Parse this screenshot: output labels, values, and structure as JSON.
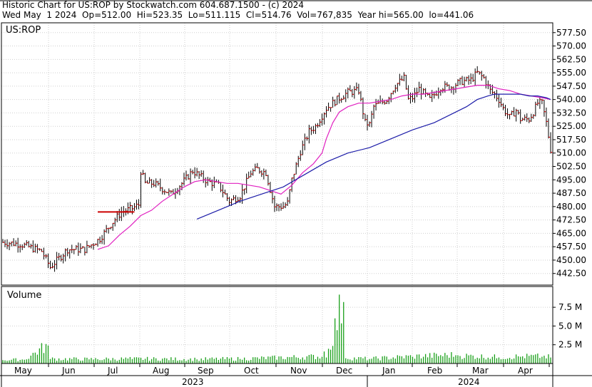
{
  "header": {
    "line1": "Historic Chart for US:ROP by Stockwatch.com 604.687.1500 - (c) 2024",
    "line2": "Wed May  1 2024  Op=512.00  Hi=523.35  Lo=511.115  Cl=514.76  Vol=767,835  Year hi=565.00  lo=441.06"
  },
  "colors": {
    "price_bar": "#000000",
    "close_tick": "#cc0000",
    "ma_short": "#e020c0",
    "ma_long": "#1c1ca8",
    "volume": "#1aa01a",
    "grid": "#cfcfcf",
    "red_marker": "#cc0000"
  },
  "chart_data": [
    {
      "type": "bar",
      "subtype": "ohlc",
      "symbol_label": "US:ROP",
      "ylim": [
        436.0,
        583.0
      ],
      "yticks": [
        "577.50",
        "570.00",
        "562.50",
        "555.00",
        "547.50",
        "540.00",
        "532.50",
        "525.00",
        "517.50",
        "510.00",
        "502.50",
        "495.00",
        "487.50",
        "480.00",
        "472.50",
        "465.00",
        "457.50",
        "450.00",
        "442.50"
      ],
      "months": [
        "May",
        "Jun",
        "Jul",
        "Aug",
        "Sep",
        "Oct",
        "Nov",
        "Dec",
        "Jan",
        "Feb",
        "Mar",
        "Apr"
      ],
      "years": [
        "2023",
        "2024"
      ],
      "grid": true,
      "anchors_close": [
        [
          0,
          460
        ],
        [
          8,
          459
        ],
        [
          18,
          455
        ],
        [
          22,
          446
        ],
        [
          30,
          456
        ],
        [
          38,
          456
        ],
        [
          45,
          462
        ],
        [
          50,
          470
        ],
        [
          55,
          477
        ],
        [
          60,
          479
        ],
        [
          63,
          481
        ],
        [
          64,
          500
        ],
        [
          66,
          493
        ],
        [
          70,
          493
        ],
        [
          78,
          487
        ],
        [
          83,
          493
        ],
        [
          88,
          500
        ],
        [
          95,
          494
        ],
        [
          100,
          492
        ],
        [
          105,
          483
        ],
        [
          110,
          486
        ],
        [
          115,
          499
        ],
        [
          118,
          501
        ],
        [
          122,
          499
        ],
        [
          126,
          480
        ],
        [
          130,
          480
        ],
        [
          132,
          482
        ],
        [
          134,
          495
        ],
        [
          138,
          511
        ],
        [
          142,
          522
        ],
        [
          145,
          525
        ],
        [
          150,
          535
        ],
        [
          155,
          540
        ],
        [
          160,
          544
        ],
        [
          165,
          545
        ],
        [
          168,
          527
        ],
        [
          170,
          526
        ],
        [
          172,
          536
        ],
        [
          175,
          538
        ],
        [
          178,
          540
        ],
        [
          182,
          548
        ],
        [
          186,
          552
        ],
        [
          188,
          540
        ],
        [
          190,
          541
        ],
        [
          193,
          546
        ],
        [
          198,
          540
        ],
        [
          203,
          547
        ],
        [
          208,
          547
        ],
        [
          212,
          550
        ],
        [
          217,
          551
        ],
        [
          220,
          555
        ],
        [
          223,
          552
        ],
        [
          226,
          545
        ],
        [
          228,
          543
        ],
        [
          230,
          540
        ],
        [
          232,
          535
        ],
        [
          235,
          530
        ],
        [
          238,
          534
        ],
        [
          240,
          529
        ],
        [
          244,
          529
        ],
        [
          246,
          533
        ],
        [
          248,
          538
        ],
        [
          250,
          538
        ],
        [
          252,
          527
        ],
        [
          254,
          512
        ]
      ],
      "ma_short_points": [
        [
          44,
          456
        ],
        [
          49,
          458
        ],
        [
          54,
          464
        ],
        [
          59,
          469
        ],
        [
          64,
          475
        ],
        [
          69,
          478
        ],
        [
          74,
          483
        ],
        [
          79,
          487
        ],
        [
          84,
          491
        ],
        [
          89,
          494
        ],
        [
          94,
          495
        ],
        [
          99,
          494
        ],
        [
          104,
          493
        ],
        [
          109,
          493
        ],
        [
          114,
          492
        ],
        [
          119,
          491
        ],
        [
          124,
          489
        ],
        [
          129,
          487
        ],
        [
          134,
          492
        ],
        [
          139,
          499
        ],
        [
          144,
          504
        ],
        [
          148,
          510
        ],
        [
          150,
          518
        ],
        [
          153,
          527
        ],
        [
          156,
          533
        ],
        [
          160,
          536
        ],
        [
          165,
          538
        ],
        [
          170,
          538
        ],
        [
          175,
          539
        ],
        [
          180,
          540
        ],
        [
          185,
          542
        ],
        [
          190,
          543
        ],
        [
          195,
          543
        ],
        [
          200,
          544
        ],
        [
          205,
          545
        ],
        [
          210,
          546
        ],
        [
          215,
          547
        ],
        [
          220,
          548
        ],
        [
          225,
          548
        ],
        [
          230,
          546
        ],
        [
          235,
          545
        ],
        [
          240,
          543
        ],
        [
          245,
          542
        ],
        [
          250,
          541
        ],
        [
          254,
          540
        ]
      ],
      "ma_long_points": [
        [
          90,
          473
        ],
        [
          100,
          478
        ],
        [
          110,
          483
        ],
        [
          120,
          487
        ],
        [
          130,
          491
        ],
        [
          140,
          498
        ],
        [
          150,
          505
        ],
        [
          160,
          510
        ],
        [
          170,
          513
        ],
        [
          180,
          518
        ],
        [
          190,
          523
        ],
        [
          200,
          527
        ],
        [
          210,
          533
        ],
        [
          215,
          536
        ],
        [
          220,
          540
        ],
        [
          225,
          542
        ],
        [
          228,
          543
        ],
        [
          232,
          543
        ],
        [
          236,
          543
        ],
        [
          240,
          543
        ],
        [
          244,
          542
        ],
        [
          248,
          542
        ],
        [
          252,
          541
        ],
        [
          254,
          540
        ]
      ],
      "red_hline": {
        "value": 477,
        "from_index": 44,
        "to_index": 61
      }
    },
    {
      "type": "bar",
      "title": "Volume",
      "yticks": [
        "7.5 M",
        "5.0 M",
        "2.5 M"
      ],
      "ylim": [
        0,
        9.7
      ],
      "anchors_volume": [
        [
          0,
          0.45
        ],
        [
          10,
          0.5
        ],
        [
          21,
          2.4
        ],
        [
          22,
          0.6
        ],
        [
          40,
          0.55
        ],
        [
          60,
          0.6
        ],
        [
          90,
          0.55
        ],
        [
          110,
          0.6
        ],
        [
          148,
          0.9
        ],
        [
          149,
          1.6
        ],
        [
          150,
          0.8
        ],
        [
          158,
          8.2
        ],
        [
          159,
          0.7
        ],
        [
          170,
          0.6
        ],
        [
          190,
          0.9
        ],
        [
          210,
          1.1
        ],
        [
          212,
          1.0
        ],
        [
          230,
          0.8
        ],
        [
          240,
          0.9
        ],
        [
          250,
          0.9
        ],
        [
          254,
          0.8
        ]
      ]
    }
  ]
}
